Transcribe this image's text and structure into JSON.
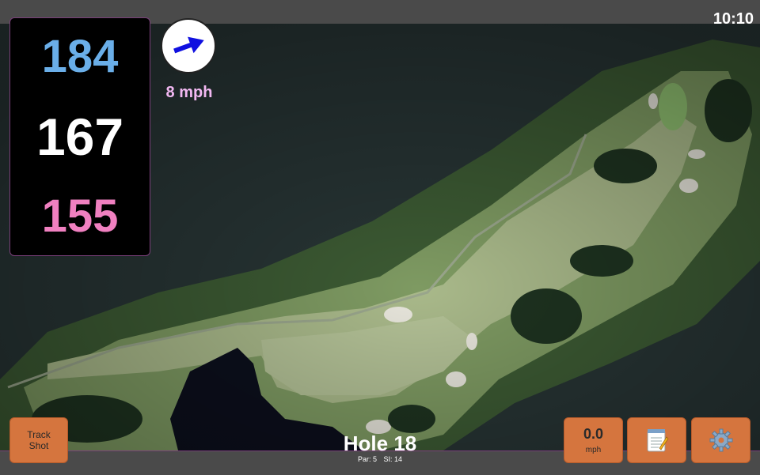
{
  "status_bar": {
    "time": "10:10"
  },
  "distances": {
    "back": "184",
    "center": "167",
    "front": "155"
  },
  "wind": {
    "speed": "8 mph",
    "direction_icon": "wind-arrow-icon"
  },
  "hole": {
    "title": "Hole 18",
    "par": "Par: 5",
    "stroke_index": "SI: 14"
  },
  "buttons": {
    "track_shot": "Track\nShot",
    "speed_value": "0.0",
    "speed_unit": "mph",
    "notes_icon": "notepad-icon",
    "settings_icon": "gear-icon"
  },
  "colors": {
    "back_distance": "#6aaee8",
    "center_distance": "#ffffff",
    "front_distance": "#f080c0",
    "wind_text": "#f2b8f2",
    "button": "#d5753e",
    "accent_border": "#7a3f7a"
  }
}
